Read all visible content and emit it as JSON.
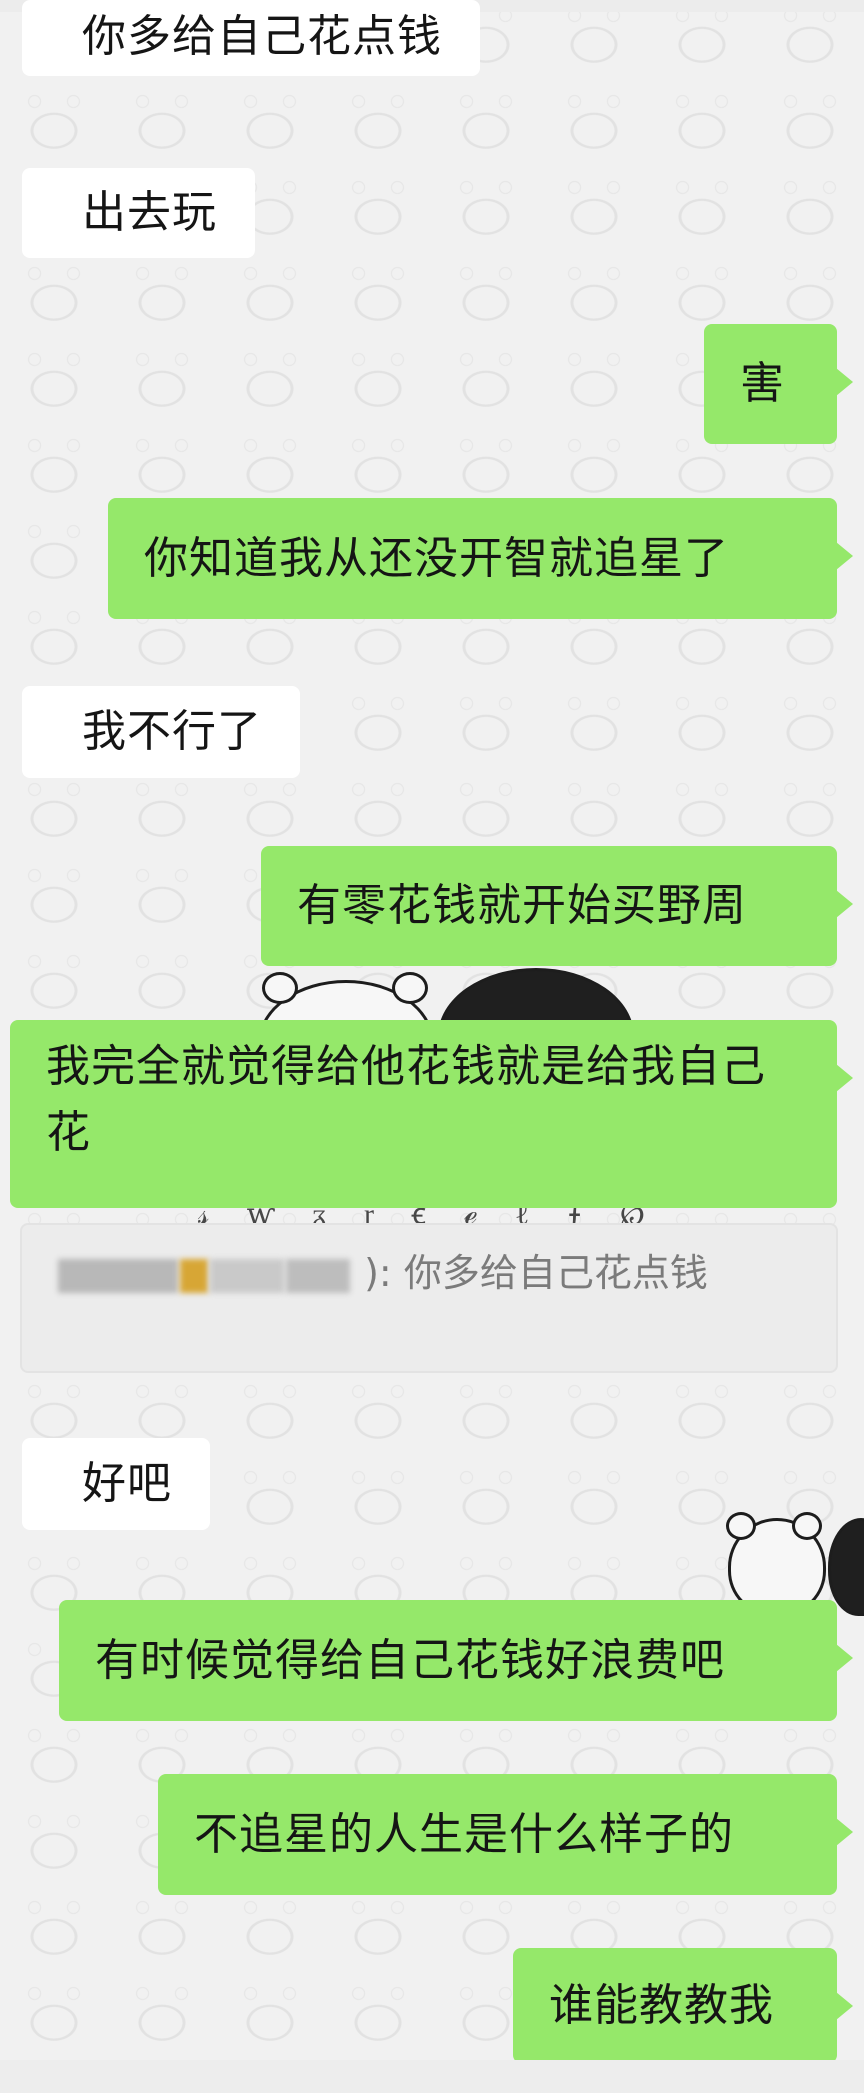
{
  "messages": {
    "m1": "你多给自己花点钱",
    "m2": "出去玩",
    "m3": "害",
    "m4": "你知道我从还没开智就追星了",
    "m5": "我不行了",
    "m6": "有零花钱就开始买野周",
    "m7": "我完全就觉得给他花钱就是给我自己花",
    "m9": "好吧",
    "m10": "有时候觉得给自己花钱好浪费吧",
    "m11": "不追星的人生是什么样子的",
    "m12": "谁能教教我"
  },
  "quote": {
    "quoted_text": "你多给自己花点钱"
  },
  "colors": {
    "outgoing_bubble": "#95e86a",
    "incoming_bubble": "#ffffff",
    "quote_background": "#ececec",
    "chat_background": "#f1f1f1"
  }
}
